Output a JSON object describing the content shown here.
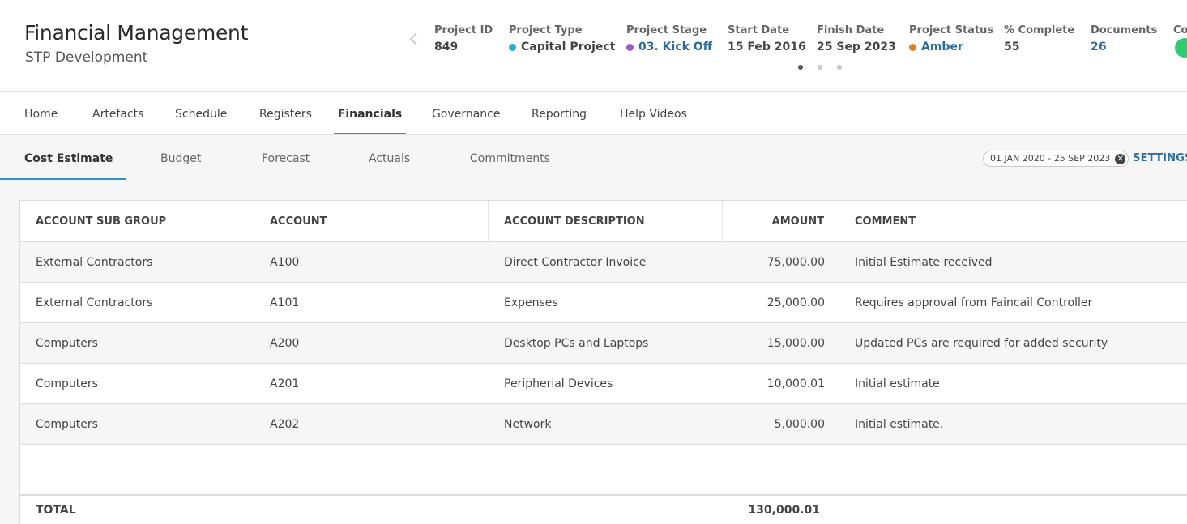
{
  "header": {
    "title": "Financial Management",
    "subtitle": "STP Development",
    "meta": [
      {
        "label": "Project ID",
        "value": "849"
      },
      {
        "label": "Project Type",
        "value": "Capital Project",
        "dot_color": "#2fa8e0"
      },
      {
        "label": "Project Stage",
        "value": "03. Kick Off",
        "dot_color": "#9b59c6"
      },
      {
        "label": "Start Date",
        "value": "15 Feb 2016"
      },
      {
        "label": "Finish Date",
        "value": "25 Sep 2023"
      },
      {
        "label": "Project Status",
        "value": "Amber",
        "dot_color": "#e67e22"
      },
      {
        "label": "% Complete",
        "value": "55"
      },
      {
        "label": "Documents",
        "value": "26"
      },
      {
        "label": "Co"
      }
    ]
  },
  "main_nav": {
    "tabs": [
      {
        "label": "Home"
      },
      {
        "label": "Artefacts"
      },
      {
        "label": "Schedule"
      },
      {
        "label": "Registers"
      },
      {
        "label": "Financials",
        "active": true
      },
      {
        "label": "Governance"
      },
      {
        "label": "Reporting"
      },
      {
        "label": "Help Videos"
      }
    ]
  },
  "sub_nav": {
    "tabs": [
      {
        "label": "Cost Estimate",
        "active": true
      },
      {
        "label": "Budget"
      },
      {
        "label": "Forecast"
      },
      {
        "label": "Actuals"
      },
      {
        "label": "Commitments"
      }
    ],
    "date_range": "01 JAN 2020 - 25 SEP 2023",
    "settings_label": "SETTINGS"
  },
  "table": {
    "columns": [
      "ACCOUNT SUB GROUP",
      "ACCOUNT",
      "ACCOUNT DESCRIPTION",
      "AMOUNT",
      "COMMENT"
    ],
    "rows": [
      [
        "External Contractors",
        "A100",
        "Direct Contractor Invoice",
        "75,000.00",
        "Initial Estimate received"
      ],
      [
        "External Contractors",
        "A101",
        "Expenses",
        "25,000.00",
        "Requires approval from Faincail Controller"
      ],
      [
        "Computers",
        "A200",
        "Desktop PCs and Laptops",
        "15,000.00",
        "Updated PCs are required for added security"
      ],
      [
        "Computers",
        "A201",
        "Peripherial Devices",
        "10,000.01",
        "Initial estimate"
      ],
      [
        "Computers",
        "A202",
        "Network",
        "5,000.00",
        "Initial estimate."
      ]
    ],
    "total_label": "TOTAL",
    "total_amount": "130,000.01"
  },
  "colors": {
    "accent": "#2f8fcf",
    "link": "#2a6d9a"
  }
}
